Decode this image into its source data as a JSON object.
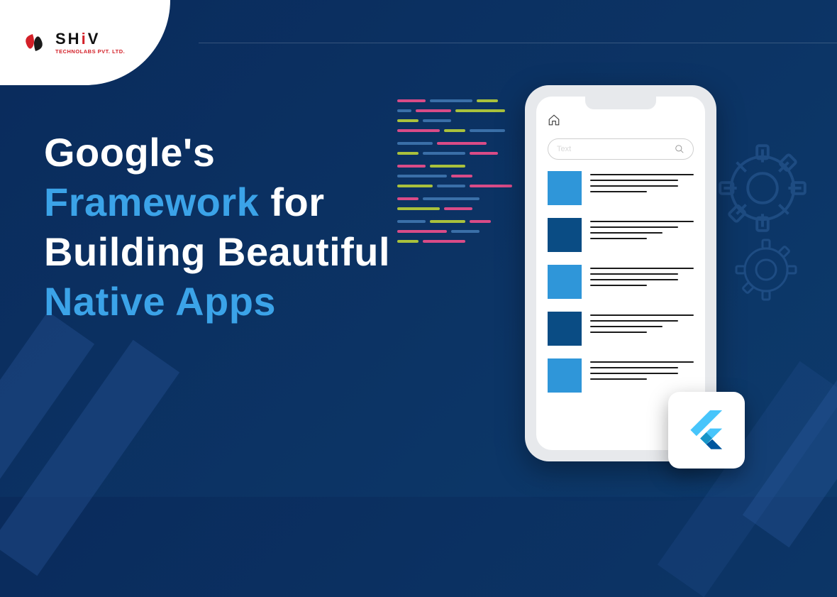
{
  "logo": {
    "main_pre": "SH",
    "main_accent": "i",
    "main_post": "V",
    "sub": "TECHNOLABS PVT. LTD."
  },
  "headline": {
    "line1_pre": "Google's",
    "line2_accent": "Framework",
    "line2_post": " for",
    "line3": "Building Beautiful",
    "line4_accent": "Native Apps"
  },
  "phone": {
    "search_placeholder": "Text"
  },
  "icons": {
    "home": "home-icon",
    "search": "search-icon",
    "flutter": "flutter-logo-icon",
    "gear": "gear-icon"
  },
  "colors": {
    "bg_start": "#0a2b5c",
    "bg_end": "#0d3a6b",
    "accent_text": "#3ba3e8",
    "brand_red": "#d32028",
    "tile_light": "#2f96d9",
    "tile_dark": "#0a4c84"
  }
}
